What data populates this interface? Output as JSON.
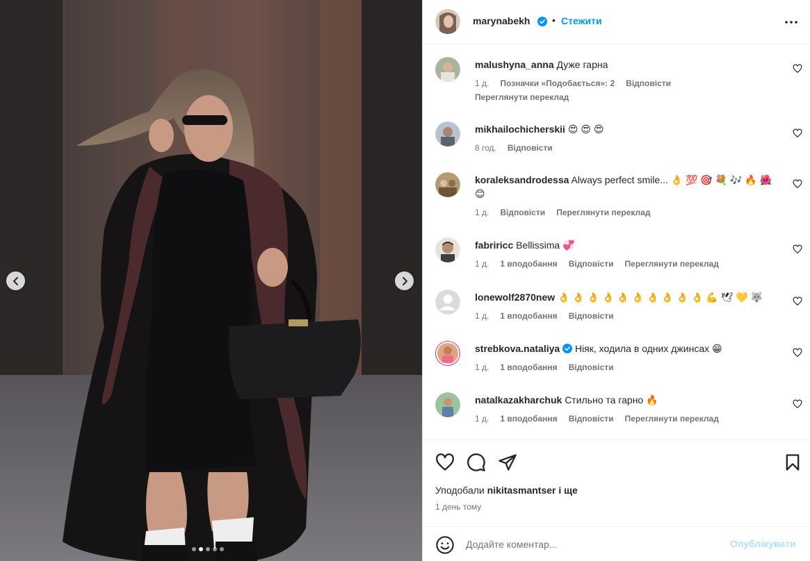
{
  "post": {
    "author": "marynabekh",
    "verified": true,
    "separator": "•",
    "follow_label": "Стежити",
    "more_icon": "more-horizontal-icon",
    "image_description_icon": "photo",
    "carousel": {
      "dots": 5,
      "active_index": 1
    }
  },
  "comments": [
    {
      "user": "malushyna_anna",
      "text": "Дуже гарна",
      "time": "1 д.",
      "likes": "Позначки «Подобається»: 2",
      "reply": "Відповісти",
      "translate": "Переглянути переклад",
      "verified": false
    },
    {
      "user": "mikhailochicherskii",
      "text": "😍 😍 😍",
      "time": "8 год.",
      "likes": "",
      "reply": "Відповісти",
      "translate": "",
      "verified": false
    },
    {
      "user": "koraleksandrodessa",
      "text": "Always perfect smile... 👌 💯 🎯 💐 🎶 🔥 🌺 😊",
      "time": "1 д.",
      "likes": "",
      "reply": "Відповісти",
      "translate": "Переглянути переклад",
      "verified": false
    },
    {
      "user": "fabriricc",
      "text": "Bellissima 💞",
      "time": "1 д.",
      "likes": "1 вподобання",
      "reply": "Відповісти",
      "translate": "Переглянути переклад",
      "verified": false
    },
    {
      "user": "lonewolf2870new",
      "text": "👌 👌 👌 👌 👌 👌 👌 👌 👌 👌 💪 🕊 💛 🐺",
      "time": "1 д.",
      "likes": "1 вподобання",
      "reply": "Відповісти",
      "translate": "",
      "verified": false
    },
    {
      "user": "strebkova.nataliya",
      "text": "Ніяк, ходила в одних джинсах 😁",
      "time": "1 д.",
      "likes": "1 вподобання",
      "reply": "Відповісти",
      "translate": "",
      "verified": true
    },
    {
      "user": "natalkazakharchuk",
      "text": "Стильно та гарно 🔥",
      "time": "1 д.",
      "likes": "1 вподобання",
      "reply": "Відповісти",
      "translate": "Переглянути переклад",
      "verified": false
    }
  ],
  "footer": {
    "liked_by_prefix": "Уподобали",
    "liked_by_user": "nikitasmantser",
    "liked_by_suffix": "і ще",
    "posted_time": "1 день тому",
    "comment_placeholder": "Додайте коментар...",
    "post_label": "Опублікувати"
  },
  "colors": {
    "accent": "#0095f6",
    "post_disabled": "#b2dffc",
    "muted_text": "#737373",
    "primary_text": "#262626"
  }
}
